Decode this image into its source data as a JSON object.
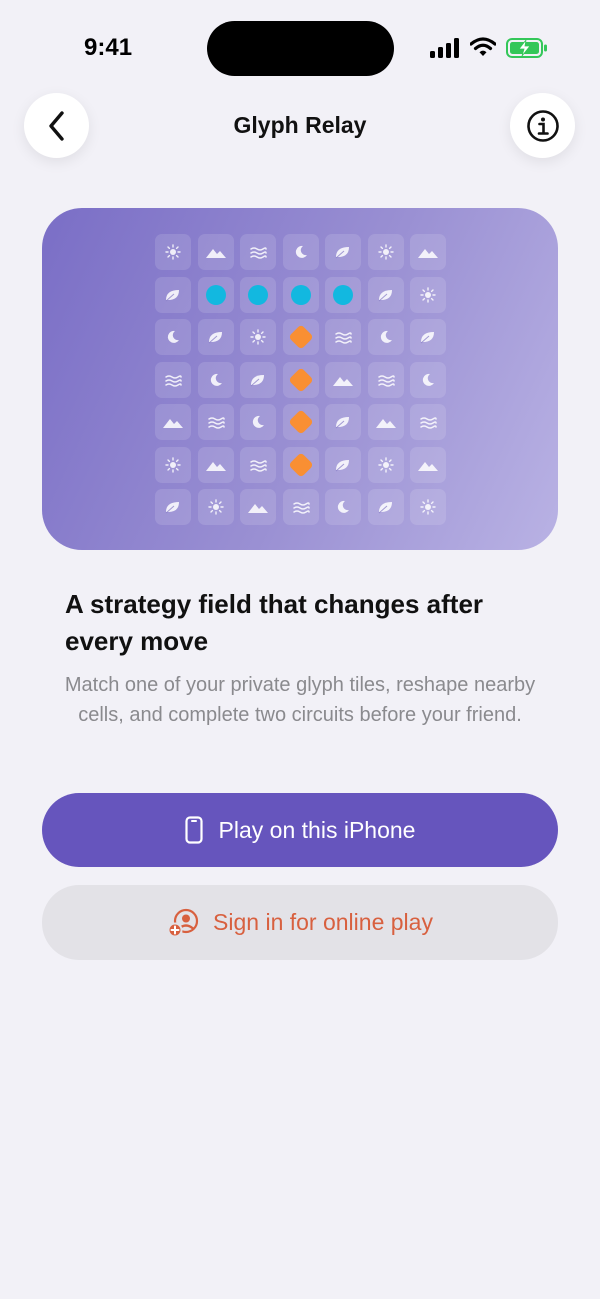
{
  "status_bar": {
    "time": "9:41",
    "icons": [
      "cellular-signal-icon",
      "wifi-icon",
      "battery-charging-icon"
    ]
  },
  "nav": {
    "title": "Glyph Relay",
    "back_icon": "chevron-left-icon",
    "info_icon": "info-circle-icon"
  },
  "hero": {
    "rows": [
      [
        "sun",
        "mountain",
        "waves",
        "moon",
        "leaf",
        "sun",
        "mountain"
      ],
      [
        "leaf",
        "cyan",
        "cyan",
        "cyan",
        "cyan",
        "leaf",
        "sun"
      ],
      [
        "moon",
        "leaf",
        "sun",
        "orange",
        "waves",
        "moon",
        "leaf"
      ],
      [
        "waves",
        "moon",
        "leaf",
        "orange",
        "mountain",
        "waves",
        "moon"
      ],
      [
        "mountain",
        "waves",
        "moon",
        "orange",
        "leaf",
        "mountain",
        "waves"
      ],
      [
        "sun",
        "mountain",
        "waves",
        "orange",
        "leaf",
        "sun",
        "mountain"
      ],
      [
        "leaf",
        "sun",
        "mountain",
        "waves",
        "moon",
        "leaf",
        "sun"
      ]
    ],
    "colors": {
      "cyan_piece": "#12b8e0",
      "orange_piece": "#f98f33"
    }
  },
  "content": {
    "headline": "A strategy field that changes after every move",
    "subtitle": "Match one of your private glyph tiles, reshape nearby cells, and complete two circuits before your friend."
  },
  "actions": {
    "play_local": {
      "label": "Play on this iPhone",
      "icon": "iphone-icon",
      "color": "#6655bd"
    },
    "sign_in": {
      "label": "Sign in for online play",
      "icon": "person-add-icon",
      "color": "#d8603f"
    }
  }
}
